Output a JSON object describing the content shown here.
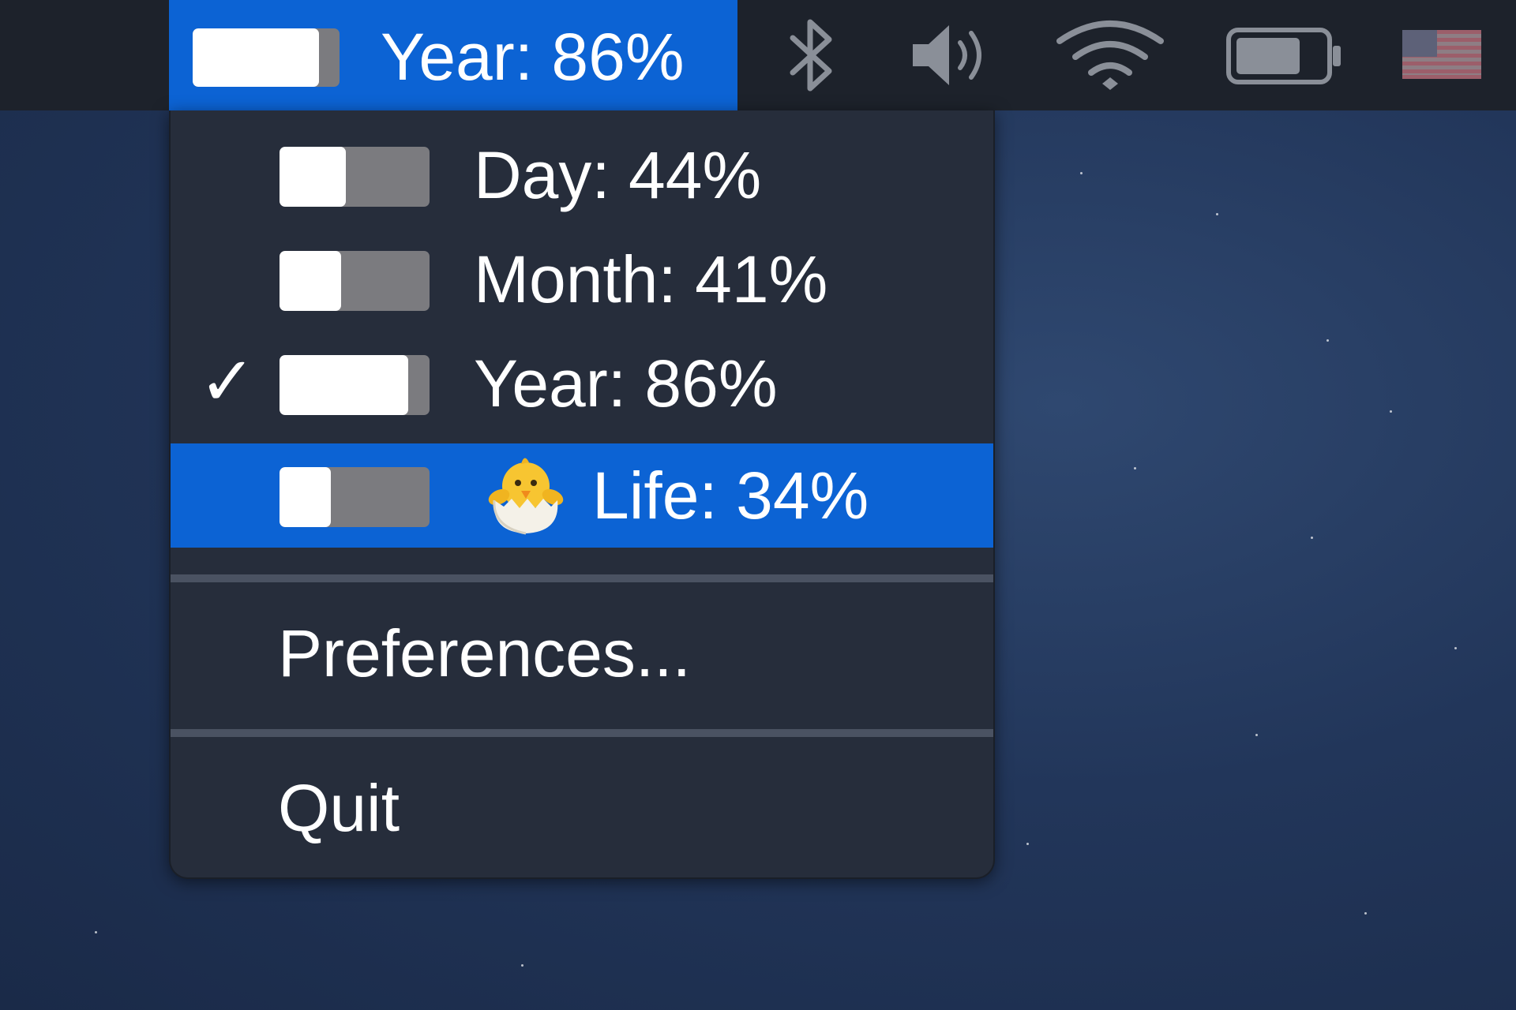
{
  "menubar": {
    "status_item": {
      "label": "Year: 86%",
      "progress": 0.86
    },
    "tray_icons": [
      "bluetooth-icon",
      "volume-icon",
      "wifi-icon",
      "battery-icon",
      "us-flag-icon"
    ]
  },
  "menu": {
    "items": [
      {
        "label": "Day: 44%",
        "progress": 0.44,
        "checked": false,
        "highlighted": false
      },
      {
        "label": "Month: 41%",
        "progress": 0.41,
        "checked": false,
        "highlighted": false
      },
      {
        "label": "Year: 86%",
        "progress": 0.86,
        "checked": true,
        "highlighted": false
      },
      {
        "label": "Life: 34%",
        "progress": 0.34,
        "checked": false,
        "highlighted": true,
        "emoji": "hatching-chick-icon"
      }
    ],
    "check_glyph": "✓",
    "preferences_label": "Preferences...",
    "quit_label": "Quit"
  },
  "colors": {
    "accent": "#0c63d4",
    "menubar": "#1d222b",
    "menu_background": "#262d3b",
    "progress_fill": "#ffffff",
    "progress_track": "#7b7b7f"
  }
}
